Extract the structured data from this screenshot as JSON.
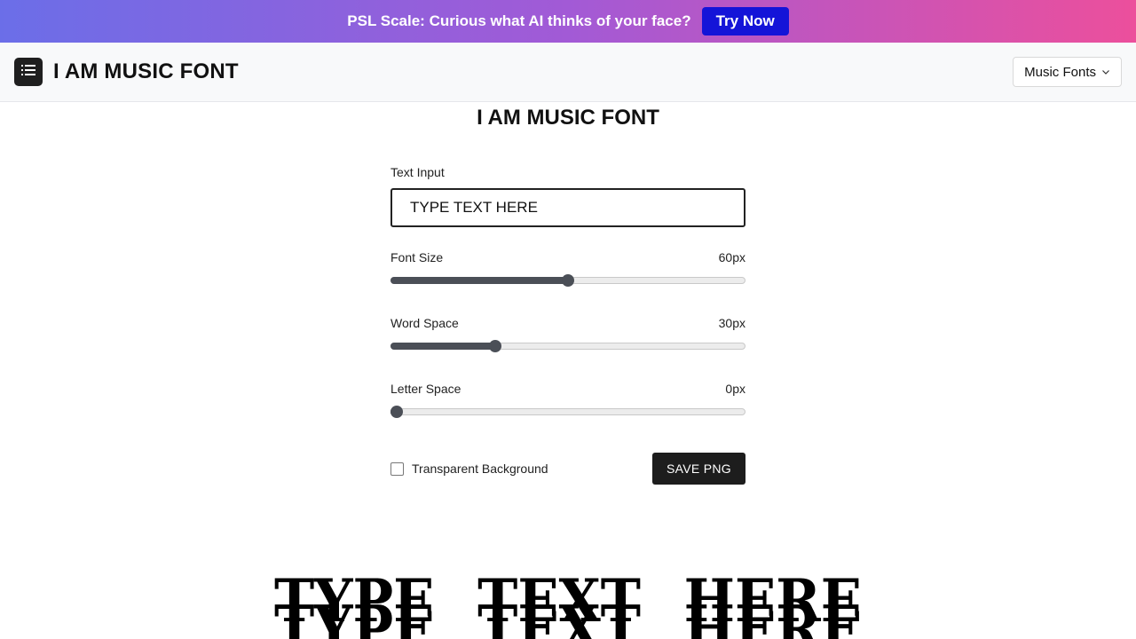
{
  "promo": {
    "text": "PSL Scale: Curious what AI thinks of your face?",
    "button_label": "Try Now"
  },
  "header": {
    "title": "I AM MUSIC FONT",
    "menu_icon": "sidebar-menu-icon",
    "dropdown_label": "Music Fonts",
    "dropdown_icon": "chevron-down-icon"
  },
  "main": {
    "title": "I AM MUSIC FONT",
    "text_input": {
      "label": "Text Input",
      "value": "TYPE TEXT HERE"
    },
    "sliders": [
      {
        "label": "Font Size",
        "value_text": "60px",
        "fraction": 0.5
      },
      {
        "label": "Word Space",
        "value_text": "30px",
        "fraction": 0.295
      },
      {
        "label": "Letter Space",
        "value_text": "0px",
        "fraction": 0.0
      }
    ],
    "checkbox": {
      "label": "Transparent Background",
      "checked": false
    },
    "save_label": "SAVE PNG"
  },
  "preview": {
    "text": "TYPE TEXT HERE"
  },
  "colors": {
    "accent_dark": "#1d1d1d",
    "promo_button": "#1414d8",
    "slider_fill": "#4b4f57"
  }
}
